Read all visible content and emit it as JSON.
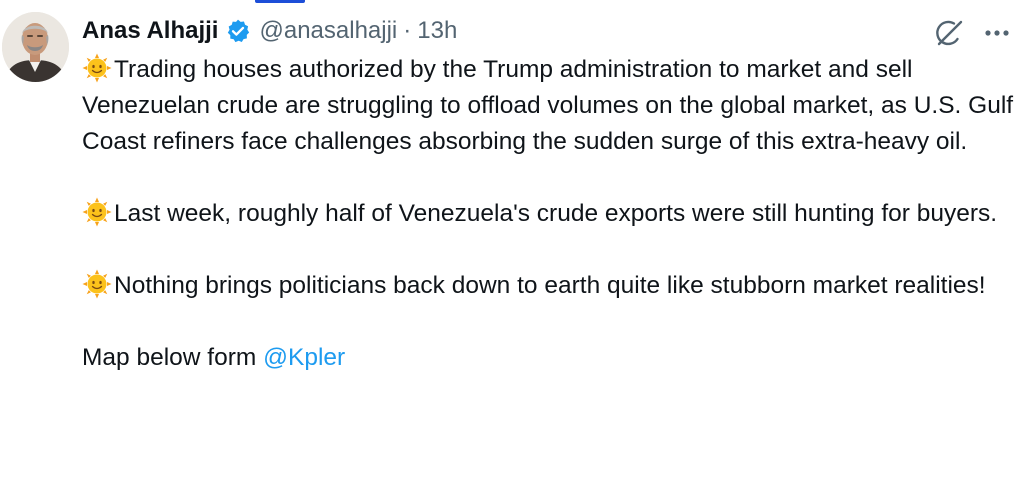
{
  "tweet": {
    "author": {
      "name": "Anas Alhajji",
      "handle": "@anasalhajji",
      "verified": true,
      "separator": "·",
      "time": "13h"
    },
    "paragraphs": [
      {
        "emoji": "sun-with-face-icon",
        "text": "Trading houses authorized by the Trump administration to market and sell Venezuelan crude are struggling to offload volumes on the global market, as U.S. Gulf Coast refiners face challenges absorbing the sudden surge of this extra-heavy oil."
      },
      {
        "emoji": "sun-with-face-icon",
        "text": "Last week, roughly half of Venezuela's crude exports were still hunting for buyers."
      },
      {
        "emoji": "sun-with-face-icon",
        "text": "Nothing brings politicians back down to earth quite like stubborn market realities!"
      }
    ],
    "footer": {
      "prefix": "Map below form ",
      "mention": "@Kpler"
    },
    "actions": {
      "grok_icon": "grok-icon",
      "more_icon": "more-options-icon"
    }
  },
  "colors": {
    "text": "#0f1419",
    "secondary": "#536471",
    "link": "#1d9bf0",
    "verified": "#1d9bf0"
  }
}
